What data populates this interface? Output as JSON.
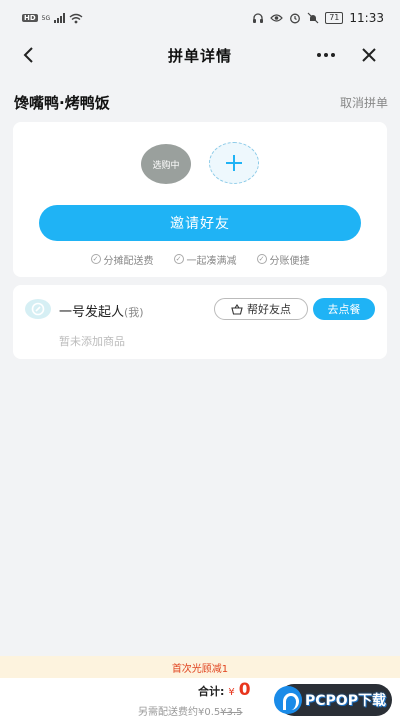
{
  "status_bar": {
    "hd": "HD",
    "network": "5G",
    "battery": "71",
    "time": "11:33"
  },
  "nav": {
    "title": "拼单详情",
    "back_icon": "chevron-left-icon",
    "more_icon": "more-dots-icon",
    "close_icon": "close-icon"
  },
  "shop": {
    "name": "馋嘴鸭·烤鸭饭",
    "cancel_label": "取消拼单"
  },
  "invite_card": {
    "selecting_label": "选购中",
    "invite_label": "邀请好友",
    "perks": [
      "分摊配送费",
      "一起凑满减",
      "分账便捷"
    ]
  },
  "member": {
    "name": "一号发起人",
    "tag": "(我)",
    "help_label": "帮好友点",
    "order_label": "去点餐",
    "empty_text": "暂未添加商品"
  },
  "discount_banner": "首次光顾减1",
  "bottom": {
    "total_label": "合计:",
    "currency": "¥",
    "total_value": "0",
    "delivery_prefix": "另需配送费约¥0.5",
    "delivery_original": "¥3.5"
  },
  "watermark": "PCPOP下载",
  "colors": {
    "accent": "#1fb3f5",
    "price": "#e8361d",
    "banner_bg": "#fdf3de"
  }
}
